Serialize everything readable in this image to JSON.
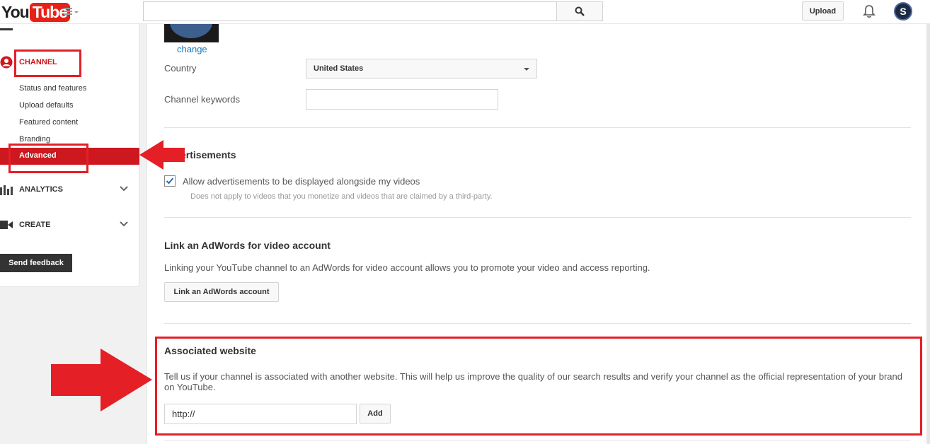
{
  "header": {
    "logo_you": "You",
    "logo_tube": "Tube",
    "search": {
      "value": "",
      "placeholder": ""
    },
    "upload_label": "Upload",
    "avatar_letter": "S"
  },
  "sidebar": {
    "channel_label": "CHANNEL",
    "channel_items": [
      "Status and features",
      "Upload defaults",
      "Featured content",
      "Branding",
      "Advanced"
    ],
    "active_item": "Advanced",
    "analytics_label": "ANALYTICS",
    "create_label": "CREATE",
    "feedback_label": "Send feedback"
  },
  "main": {
    "avatar_change_label": "change",
    "country": {
      "label": "Country",
      "value": "United States"
    },
    "keywords": {
      "label": "Channel keywords",
      "value": ""
    },
    "ads": {
      "title": "ertisements",
      "checkbox_label": "Allow advertisements to be displayed alongside my videos",
      "checked": true,
      "note": "Does not apply to videos that you monetize and videos that are claimed by a third-party."
    },
    "adwords": {
      "title": "Link an AdWords for video account",
      "description": "Linking your YouTube channel to an AdWords for video account allows you to promote your video and access reporting.",
      "button_label": "Link an AdWords account"
    },
    "website": {
      "title": "Associated website",
      "description": "Tell us if your channel is associated with another website. This will help us improve the quality of our search results and verify your channel as the official representation of your brand on YouTube.",
      "input_value": "http://",
      "add_label": "Add"
    }
  },
  "colors": {
    "brand_red": "#cc181e",
    "annotation_red": "#e41f26",
    "link_blue": "#167ac6"
  }
}
